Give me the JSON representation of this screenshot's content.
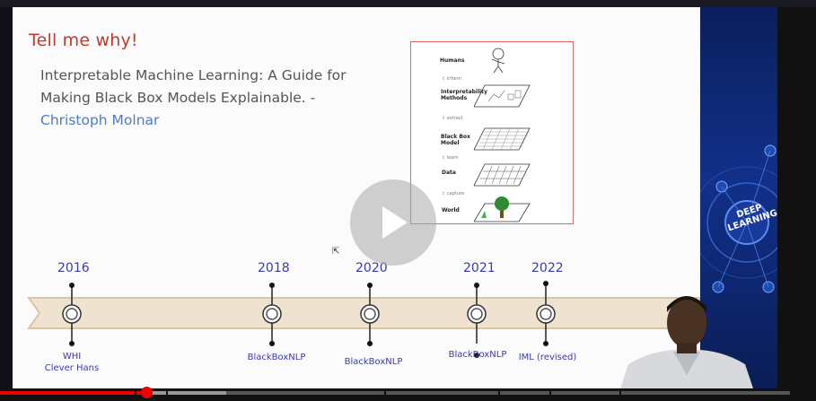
{
  "slide": {
    "title": "Tell me why!",
    "quote_line1": "Interpretable Machine Learning: A Guide for",
    "quote_line2": "Making Black Box Models Explainable. -",
    "author": "Christoph Molnar"
  },
  "figure": {
    "labels": [
      "Humans",
      "Interpretability Methods",
      "Black Box Model",
      "Data",
      "World"
    ],
    "arrows": [
      "inform",
      "extract",
      "learn",
      "capture"
    ]
  },
  "timeline": {
    "years": [
      "2016",
      "2018",
      "2020",
      "2021",
      "2022"
    ],
    "events": [
      "WHI",
      "Clever Hans",
      "BlackBoxNLP",
      "BlackBoxNLP",
      "BlackBoxNLP",
      "IML (revised)"
    ]
  },
  "side_badge": {
    "text_line1": "DEEP",
    "text_line2": "LEARNING"
  },
  "colors": {
    "title": "#c0392b",
    "author": "#4a7cc9",
    "timeline_text": "#3a3aa8",
    "timeline_band": "#efe3cf",
    "progress_played": "#e00000"
  },
  "player": {
    "progress_fraction": 0.185,
    "buffered_fraction": 0.286
  }
}
